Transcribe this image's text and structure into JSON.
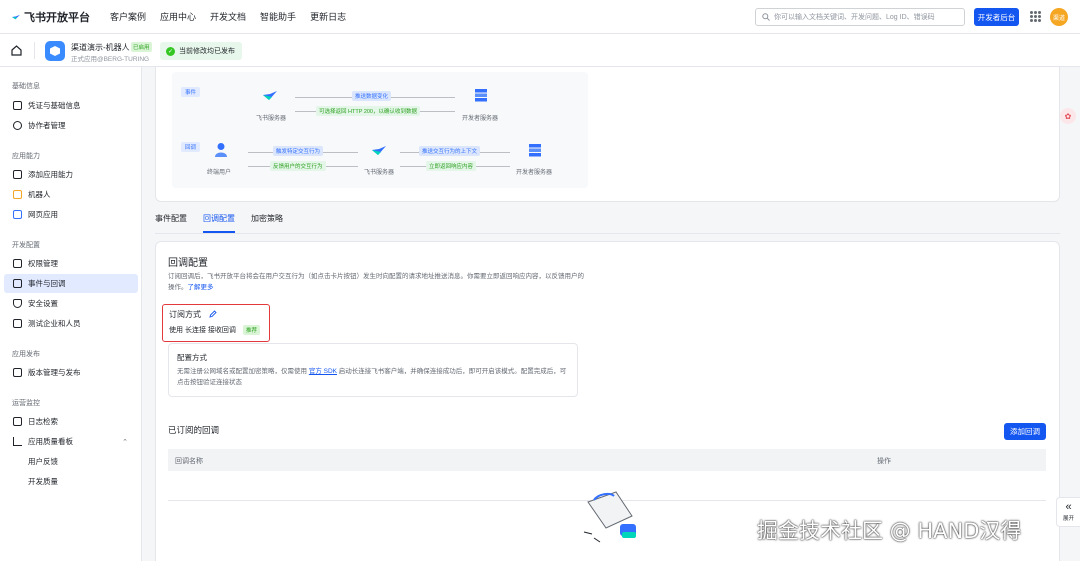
{
  "topbar": {
    "brand": "飞书开放平台",
    "nav": [
      "客户案例",
      "应用中心",
      "开发文档",
      "智能助手",
      "更新日志"
    ],
    "search_placeholder": "你可以输入文档关键词、开发问题、Log ID、错误码",
    "dev_console": "开发者后台",
    "avatar_text": "渠道"
  },
  "appbar": {
    "app_name": "渠道演示-机器人",
    "app_badge": "已启用",
    "app_sub": "正式应用@BERG-TURING",
    "publish_status": "当前修改均已发布"
  },
  "sidebar": {
    "sections": [
      {
        "title": "基础信息",
        "items": [
          "凭证与基础信息",
          "协作者管理"
        ]
      },
      {
        "title": "应用能力",
        "items": [
          "添加应用能力",
          "机器人",
          "网页应用"
        ]
      },
      {
        "title": "开发配置",
        "items": [
          "权限管理",
          "事件与回调",
          "安全设置",
          "测试企业和人员"
        ]
      },
      {
        "title": "应用发布",
        "items": [
          "版本管理与发布"
        ]
      },
      {
        "title": "运营监控",
        "items": [
          "日志检索",
          "应用质量看板",
          "用户反馈",
          "开发质量"
        ]
      }
    ],
    "active": "事件与回调"
  },
  "diagram": {
    "event_tag": "事件",
    "callback_tag": "回调",
    "feishu_server": "飞书服务器",
    "dev_server": "开发者服务器",
    "end_user": "终端用户",
    "push_change": "推送数据变化",
    "optional_return": "可选择返回 HTTP 200，以确认收到数据",
    "trigger_action": "触发特定交互行为",
    "feedback_action": "反馈用户的交互行为",
    "push_context": "推送交互行为的上下文",
    "immediate_return": "立即返回响应内容"
  },
  "tabs": [
    "事件配置",
    "回调配置",
    "加密策略"
  ],
  "active_tab": "回调配置",
  "callback": {
    "title": "回调配置",
    "desc": "订阅回调后，飞书开放平台将会在用户交互行为（如点击卡片按钮）发生时向配置的请求地址推送消息。你需要立即返回响应内容，以反馈用户的操作。",
    "learn_more": "了解更多",
    "sub_mode_title": "订阅方式",
    "sub_mode_prefix": "使用",
    "sub_mode_value": "长连接 接收回调",
    "recommended": "推荐",
    "cfg_title": "配置方式",
    "cfg_desc_1": "无需注册公网域名或配置加密策略，仅需使用",
    "cfg_sdk": "官方 SDK",
    "cfg_desc_2": "启动长连接飞书客户端，并确保连接成功后，即可开启该模式。配置完成后，可点击按钮验证连接状态",
    "subscribed_title": "已订阅的回调",
    "add_button": "添加回调",
    "col_name": "回调名称",
    "col_action": "操作"
  },
  "collapse_label": "展开",
  "watermark": "掘金技术社区 @ HAND汉得"
}
